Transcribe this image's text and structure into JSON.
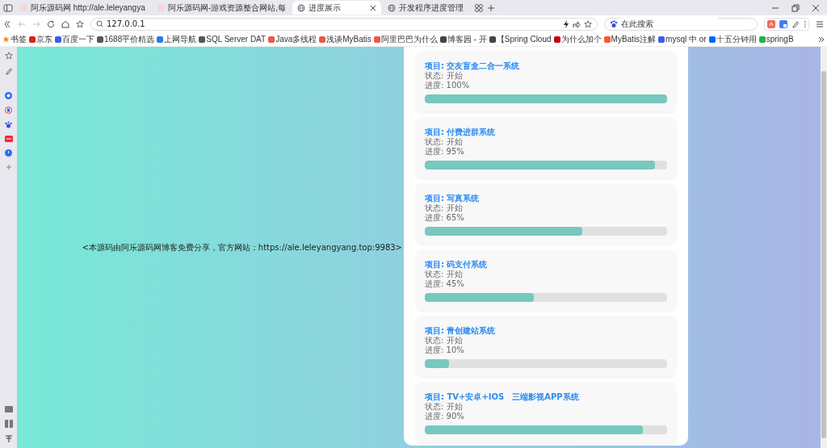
{
  "browser": {
    "tabs": [
      {
        "title": "阿乐源码网 http://ale.leleyangya",
        "selected": false
      },
      {
        "title": "阿乐源码网-游戏资源整合网站,每",
        "selected": false
      },
      {
        "title": "进度展示",
        "selected": true
      },
      {
        "title": "开发程序进度管理",
        "selected": false
      }
    ],
    "address": "127.0.0.1",
    "search_placeholder": "在此搜索",
    "bookmarks": [
      {
        "label": "书签",
        "color": "#f08a24"
      },
      {
        "label": "京东",
        "color": "#d9251c"
      },
      {
        "label": "百度一下",
        "color": "#3b5de7"
      },
      {
        "label": "1688平价精选",
        "color": "#555555"
      },
      {
        "label": "上网导航",
        "color": "#2a7de1"
      },
      {
        "label": "SQL Server DAT",
        "color": "#555555"
      },
      {
        "label": "Java多线程",
        "color": "#e8594a"
      },
      {
        "label": "浅谈MyBatis",
        "color": "#e8594a"
      },
      {
        "label": "阿里巴巴为什么",
        "color": "#e8594a"
      },
      {
        "label": "博客园 - 开",
        "color": "#444444"
      },
      {
        "label": "【Spring Cloud",
        "color": "#444444"
      },
      {
        "label": "为什么加个",
        "color": "#c7000b"
      },
      {
        "label": "MyBatis注解",
        "color": "#fc5531"
      },
      {
        "label": "mysql 中 or",
        "color": "#3b5de7"
      },
      {
        "label": "十五分钟用",
        "color": "#0066ff"
      },
      {
        "label": "springB",
        "color": "#22b14c"
      }
    ]
  },
  "page": {
    "notice": "<本源码由阿乐源码网博客免费分享，官方网站：https://ale.leleyangyang.top:9983>",
    "projects": [
      {
        "title": "项目: 交友盲盒二合一系统",
        "status": "状态: 开始",
        "progress": "进度: 100%",
        "level": 1
      },
      {
        "title": "项目: 付费进群系统",
        "status": "状态: 开始",
        "progress": "进度: 95%",
        "level": 0.95
      },
      {
        "title": "项目: 写真系统",
        "status": "状态: 开始",
        "progress": "进度: 65%",
        "level": 0.65
      },
      {
        "title": "项目: 码支付系统",
        "status": "状态: 开始",
        "progress": "进度: 45%",
        "level": 0.45
      },
      {
        "title": "项目: 青创建站系统",
        "status": "状态: 开始",
        "progress": "进度: 10%",
        "level": 0.1
      },
      {
        "title": "项目: TV+安卓+IOS　三端影视APP系统",
        "status": "状态: 开始",
        "progress": "进度: 90%",
        "level": 0.9
      }
    ]
  }
}
